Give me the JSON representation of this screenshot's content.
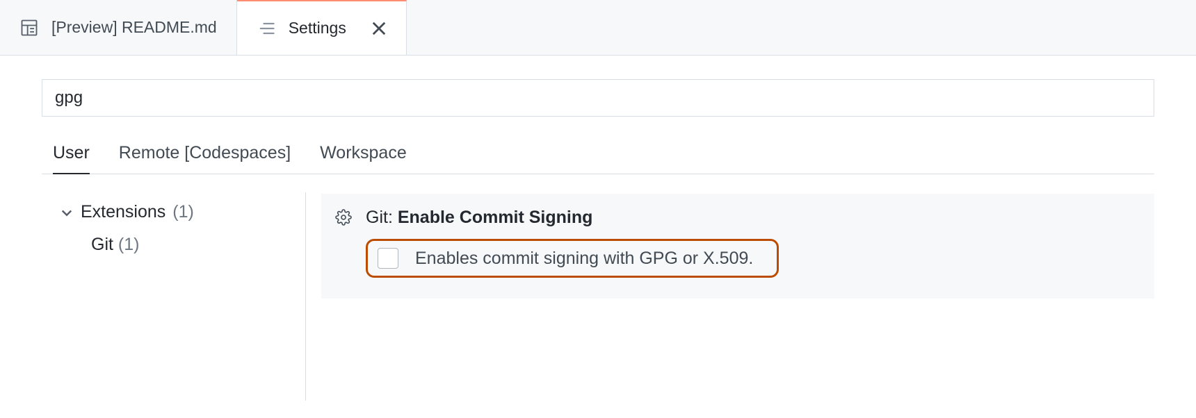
{
  "tabs": [
    {
      "label": "[Preview] README.md",
      "active": false,
      "icon": "preview"
    },
    {
      "label": "Settings",
      "active": true,
      "icon": "settings",
      "closable": true
    }
  ],
  "search": {
    "value": "gpg"
  },
  "scopes": [
    "User",
    "Remote [Codespaces]",
    "Workspace"
  ],
  "active_scope": "User",
  "tree": {
    "root": {
      "label": "Extensions",
      "count": "(1)"
    },
    "child": {
      "label": "Git",
      "count": "(1)"
    }
  },
  "setting": {
    "prefix": "Git: ",
    "name": "Enable Commit Signing",
    "description": "Enables commit signing with GPG or X.509.",
    "checked": false
  }
}
